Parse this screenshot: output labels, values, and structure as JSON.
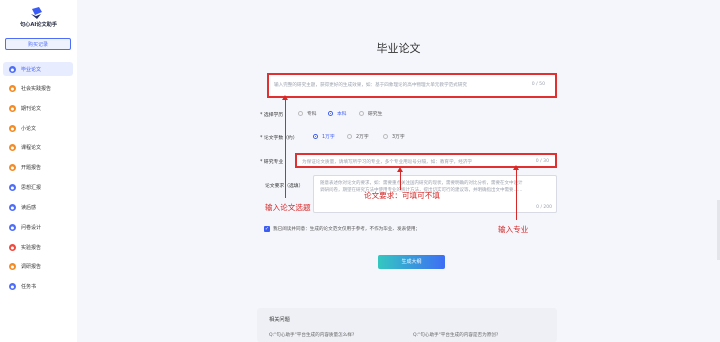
{
  "app": {
    "title": "句心AI论文助手",
    "buy_record": "购买记录"
  },
  "sidebar": {
    "items": [
      {
        "label": "毕业论文",
        "icon": "cap-icon",
        "color": "#4f6ef7"
      },
      {
        "label": "社会实践报告",
        "icon": "people-icon",
        "color": "#f28c28"
      },
      {
        "label": "期刊论文",
        "icon": "book-icon",
        "color": "#f28c28"
      },
      {
        "label": "小论文",
        "icon": "doc-icon",
        "color": "#f28c28"
      },
      {
        "label": "课程论文",
        "icon": "course-icon",
        "color": "#f28c28"
      },
      {
        "label": "开题报告",
        "icon": "report-icon",
        "color": "#f28c28"
      },
      {
        "label": "思想汇报",
        "icon": "thought-icon",
        "color": "#4f6ef7"
      },
      {
        "label": "读后感",
        "icon": "read-icon",
        "color": "#4f6ef7"
      },
      {
        "label": "问卷设计",
        "icon": "survey-icon",
        "color": "#4f6ef7"
      },
      {
        "label": "实验报告",
        "icon": "lab-icon",
        "color": "#f0493e"
      },
      {
        "label": "调研报告",
        "icon": "research-icon",
        "color": "#f28c28"
      },
      {
        "label": "任务书",
        "icon": "task-icon",
        "color": "#4f6ef7"
      }
    ]
  },
  "form": {
    "page_title": "毕业论文",
    "topic_placeholder": "输入完整的研究主题，获得更好的生成效果，如：基于四象理论的高中物理大单元教学范式研究",
    "topic_count": "0 / 50",
    "level_label": "* 选择学历",
    "levels": [
      {
        "label": "专科",
        "selected": false
      },
      {
        "label": "本科",
        "selected": true
      },
      {
        "label": "研究生",
        "selected": false
      }
    ],
    "length_label": "* 论文字数（约）",
    "lengths": [
      {
        "label": "1万字",
        "selected": true
      },
      {
        "label": "2万字",
        "selected": false
      },
      {
        "label": "3万字",
        "selected": false
      }
    ],
    "major_label": "* 研究专业",
    "major_placeholder": "为保证论文质量，请填写所学习的专业，多个专业用逗号分隔，如：教育学，经济学",
    "major_count": "0 / 30",
    "req_label": "论文要求（选填）",
    "req_placeholder": "随意表述你对论文的要求，如：需要重点关注国内研究的现状，需要明确的对比分析，需要在文中设计调研问卷，期望在研究方法中使用专业的统计方法，提出切实可行的建议等，并明确指出文中需要……",
    "req_count": "0 / 200",
    "agree_text": "我已阅读并同意：生成的论文范文仅用于参考，不作为毕业、发表使用；",
    "generate_button": "生成大纲"
  },
  "faq": {
    "title": "相关问题",
    "questions": [
      "Q:\"句心助手\"平台生成的内容质量怎么样?",
      "Q:\"句心助手\"平台生成的内容是否为原创?"
    ]
  },
  "annotations": {
    "topic": "输入论文选题",
    "requirement": "论文要求：可填可不填",
    "major": "输入专业"
  }
}
